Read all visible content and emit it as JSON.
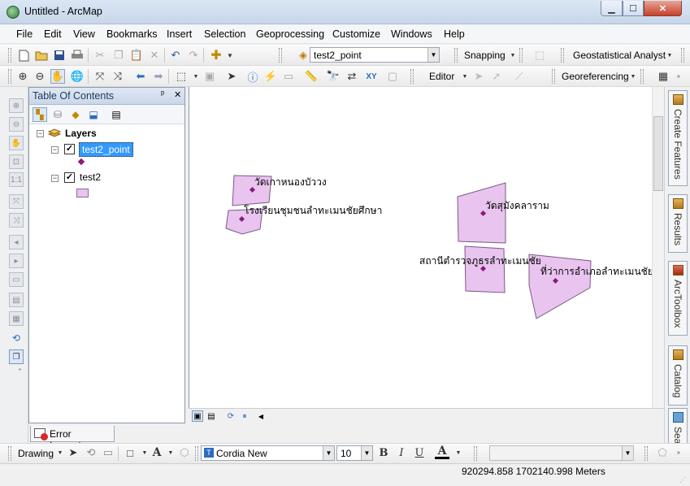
{
  "window": {
    "title": "Untitled - ArcMap",
    "min": "▁",
    "max": "☐",
    "close": "✕"
  },
  "menu": [
    "File",
    "Edit",
    "View",
    "Bookmarks",
    "Insert",
    "Selection",
    "Geoprocessing",
    "Customize",
    "Windows",
    "Help"
  ],
  "toolbar": {
    "target_layer": "test2_point",
    "snapping_label": "Snapping",
    "geostat_label": "Geostatistical Analyst",
    "editor_label": "Editor",
    "georef_label": "Georeferencing"
  },
  "toc": {
    "title": "Table Of Contents",
    "pin": "ᵖ",
    "close": "✕",
    "root_label": "Layers",
    "layers": [
      {
        "name": "test2_point",
        "checked": "✓",
        "expand": "−"
      },
      {
        "name": "test2",
        "checked": "✓",
        "expand": "−"
      }
    ]
  },
  "error_inspector": {
    "label": "Error Inspector"
  },
  "map": {
    "labels": [
      "วัดเกาหนองบัววง",
      "โรงเรียนชุมชนลำทะเมนชัยศึกษา",
      "วัดสุมังคลาราม",
      "สถานีตำรวจภูธรลำทะเมนชัย",
      "ที่ว่าการอำเภอลำทะเมนชัย"
    ],
    "polygon_fill": "#e8c4ef",
    "point_color": "#8b1a7a"
  },
  "dock": [
    "Create Features",
    "Results",
    "ArcToolbox",
    "Catalog",
    "Sea"
  ],
  "drawing": {
    "drawing_label": "Drawing",
    "font_name": "Cordia New",
    "font_size": "10",
    "bold": "B",
    "italic": "I",
    "underline": "U",
    "font_color_letter": "A"
  },
  "status": {
    "coordinates": "920294.858  1702140.998 Meters"
  }
}
